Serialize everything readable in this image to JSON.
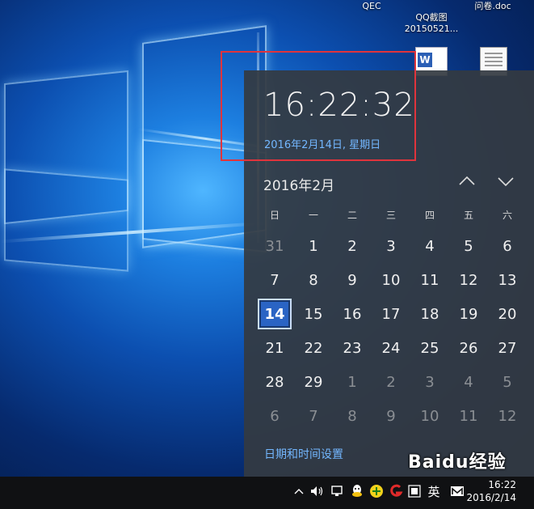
{
  "desktop": {
    "icons": [
      {
        "label": "QEC"
      },
      {
        "label": "QQ截图\n20150521..."
      },
      {
        "label": "问卷.doc"
      }
    ]
  },
  "calendar": {
    "time": "16:22:32",
    "date_long": "2016年2月14日, 星期日",
    "month_title": "2016年2月",
    "weekdays": [
      "日",
      "一",
      "二",
      "三",
      "四",
      "五",
      "六"
    ],
    "weeks": [
      [
        "31",
        "1",
        "2",
        "3",
        "4",
        "5",
        "6"
      ],
      [
        "7",
        "8",
        "9",
        "10",
        "11",
        "12",
        "13"
      ],
      [
        "14",
        "15",
        "16",
        "17",
        "18",
        "19",
        "20"
      ],
      [
        "21",
        "22",
        "23",
        "24",
        "25",
        "26",
        "27"
      ],
      [
        "28",
        "29",
        "1",
        "2",
        "3",
        "4",
        "5"
      ],
      [
        "6",
        "7",
        "8",
        "9",
        "10",
        "11",
        "12"
      ]
    ],
    "today": "14",
    "settings_link": "日期和时间设置"
  },
  "taskbar": {
    "tray_icons": [
      "chevron-up-icon",
      "volume-icon",
      "network-icon",
      "add-icon",
      "app-icon",
      "qq-icon",
      "ime-icon",
      "mail-icon"
    ],
    "ime_label": "英",
    "clock_time": "16:22",
    "clock_date": "2016/2/14"
  },
  "watermark": "Baidu经验",
  "colors": {
    "accent": "#2a64c4",
    "link": "#73b7ff",
    "highlight": "#e0343c",
    "panel": "#343a42"
  }
}
